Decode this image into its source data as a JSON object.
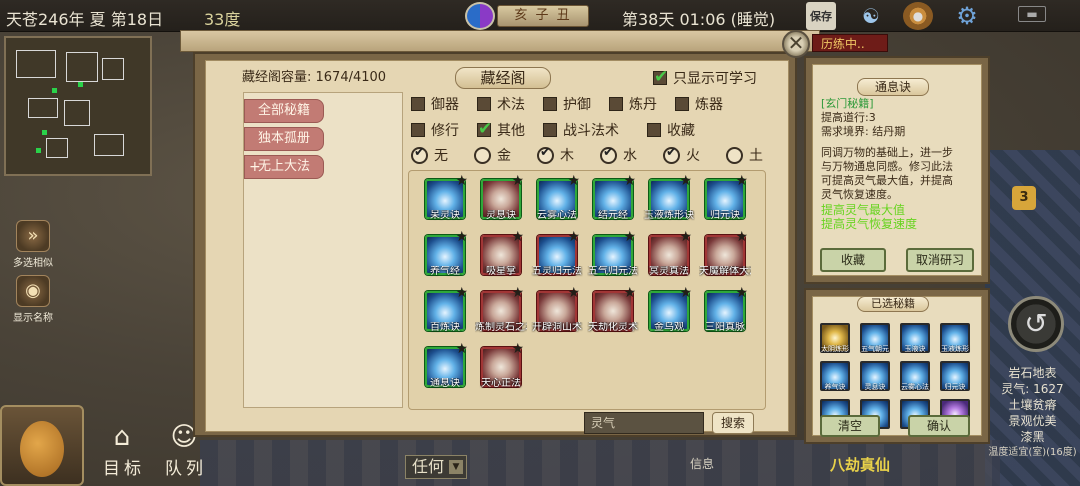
{
  "status_bar": {
    "date": "天苍246年 夏 第18日",
    "temperature": "33度",
    "zodiac": "亥 子 丑",
    "day_time": "第38天 01:06 (睡觉)"
  },
  "top_icons": [
    "save-icon",
    "scroll-icon",
    "palette-icon",
    "gear-icon",
    "menu-icon"
  ],
  "left_hud": {
    "multi_select_label": "多选相似",
    "show_names_label": "显示名称"
  },
  "bottom_bar": {
    "target_label": "目标",
    "team_label": "队列",
    "select_value": "任何",
    "info_label": "信息",
    "location": "八劫真仙"
  },
  "right_hud": {
    "badge_count": "3",
    "terrain": "岩石地表",
    "spirit": "灵气: 1627",
    "soil": "土壤贫瘠",
    "view": "景观优美",
    "light": "漆黑",
    "temp": "温度适宜(室)(16度)"
  },
  "library": {
    "title": "藏经阁",
    "capacity": "藏经阁容量: 1674/4100",
    "only_learnable_label": "只显示可学习",
    "only_learnable_checked": true,
    "training_tab": "历练中..",
    "categories": [
      {
        "label": "全部秘籍",
        "plus": false
      },
      {
        "label": "独本孤册",
        "plus": false
      },
      {
        "label": "无上大法",
        "plus": true
      }
    ],
    "type_filters_row1": [
      {
        "label": "御器",
        "checked": false
      },
      {
        "label": "术法",
        "checked": false
      },
      {
        "label": "护御",
        "checked": false
      },
      {
        "label": "炼丹",
        "checked": false
      },
      {
        "label": "炼器",
        "checked": false
      }
    ],
    "type_filters_row2": [
      {
        "label": "修行",
        "checked": false
      },
      {
        "label": "其他",
        "checked": true
      },
      {
        "label": "战斗法术",
        "checked": false
      },
      {
        "label": "收藏",
        "checked": false
      }
    ],
    "element_filters": [
      {
        "label": "无",
        "checked": true
      },
      {
        "label": "金",
        "checked": false
      },
      {
        "label": "木",
        "checked": true
      },
      {
        "label": "水",
        "checked": true
      },
      {
        "label": "火",
        "checked": true
      },
      {
        "label": "土",
        "checked": false
      }
    ],
    "skills": [
      {
        "name": "呆灵诀",
        "style": "blue",
        "frame": "green"
      },
      {
        "name": "灵息诀",
        "style": "red",
        "frame": "green"
      },
      {
        "name": "云雾心法",
        "style": "blue",
        "frame": "green"
      },
      {
        "name": "结元经",
        "style": "blue",
        "frame": "green"
      },
      {
        "name": "玉液炼形诀",
        "style": "blue",
        "frame": "green"
      },
      {
        "name": "归元诀",
        "style": "blue",
        "frame": "green"
      },
      {
        "name": "养气经",
        "style": "blue",
        "frame": "green"
      },
      {
        "name": "吸星掌",
        "style": "red",
        "frame": "red"
      },
      {
        "name": "五灵归元法",
        "style": "blue",
        "frame": "red"
      },
      {
        "name": "五气归元法",
        "style": "blue",
        "frame": "green"
      },
      {
        "name": "冥灵真法",
        "style": "red",
        "frame": "red"
      },
      {
        "name": "天魔解体大法",
        "style": "red",
        "frame": "red"
      },
      {
        "name": "百炼诀",
        "style": "blue",
        "frame": "green"
      },
      {
        "name": "炼制灵石之术",
        "style": "red",
        "frame": "red"
      },
      {
        "name": "开辟洞山术",
        "style": "red",
        "frame": "red"
      },
      {
        "name": "天劫化灵术",
        "style": "red",
        "frame": "red"
      },
      {
        "name": "金乌观",
        "style": "blue",
        "frame": "green"
      },
      {
        "name": "三阳真脉",
        "style": "blue",
        "frame": "green"
      },
      {
        "name": "通息诀",
        "style": "blue",
        "frame": "green"
      },
      {
        "name": "天心正法",
        "style": "red",
        "frame": "red"
      }
    ],
    "search_placeholder": "灵气",
    "search_button": "搜索"
  },
  "detail": {
    "title": "通息诀",
    "tag": "[玄门秘籍]",
    "bonus": "提高道行:3",
    "requirement": "需求境界: 结丹期",
    "desc_lines": [
      "同调万物的基础上，进一步",
      "与万物通息同感。修习此法",
      "可提高灵气最大值，并提高",
      "灵气恢复速度。"
    ],
    "effects": [
      "提高灵气最大值",
      "提高灵气恢复速度"
    ],
    "collect_button": "收藏",
    "cancel_button": "取消研习"
  },
  "selected": {
    "title": "已选秘籍",
    "items": [
      {
        "name": "太阴炼形",
        "style": "gold"
      },
      {
        "name": "五气朝元",
        "style": "blue"
      },
      {
        "name": "玉液诀",
        "style": "blue"
      },
      {
        "name": "玉液炼形",
        "style": "blue"
      },
      {
        "name": "养气诀",
        "style": "blue"
      },
      {
        "name": "灵息诀",
        "style": "blue"
      },
      {
        "name": "云雾心法",
        "style": "blue"
      },
      {
        "name": "归元诀",
        "style": "blue"
      },
      {
        "name": "",
        "style": "blue"
      },
      {
        "name": "",
        "style": "blue"
      },
      {
        "name": "",
        "style": "blue"
      },
      {
        "name": "",
        "style": "purple"
      }
    ],
    "clear_button": "清空",
    "confirm_button": "确认"
  }
}
